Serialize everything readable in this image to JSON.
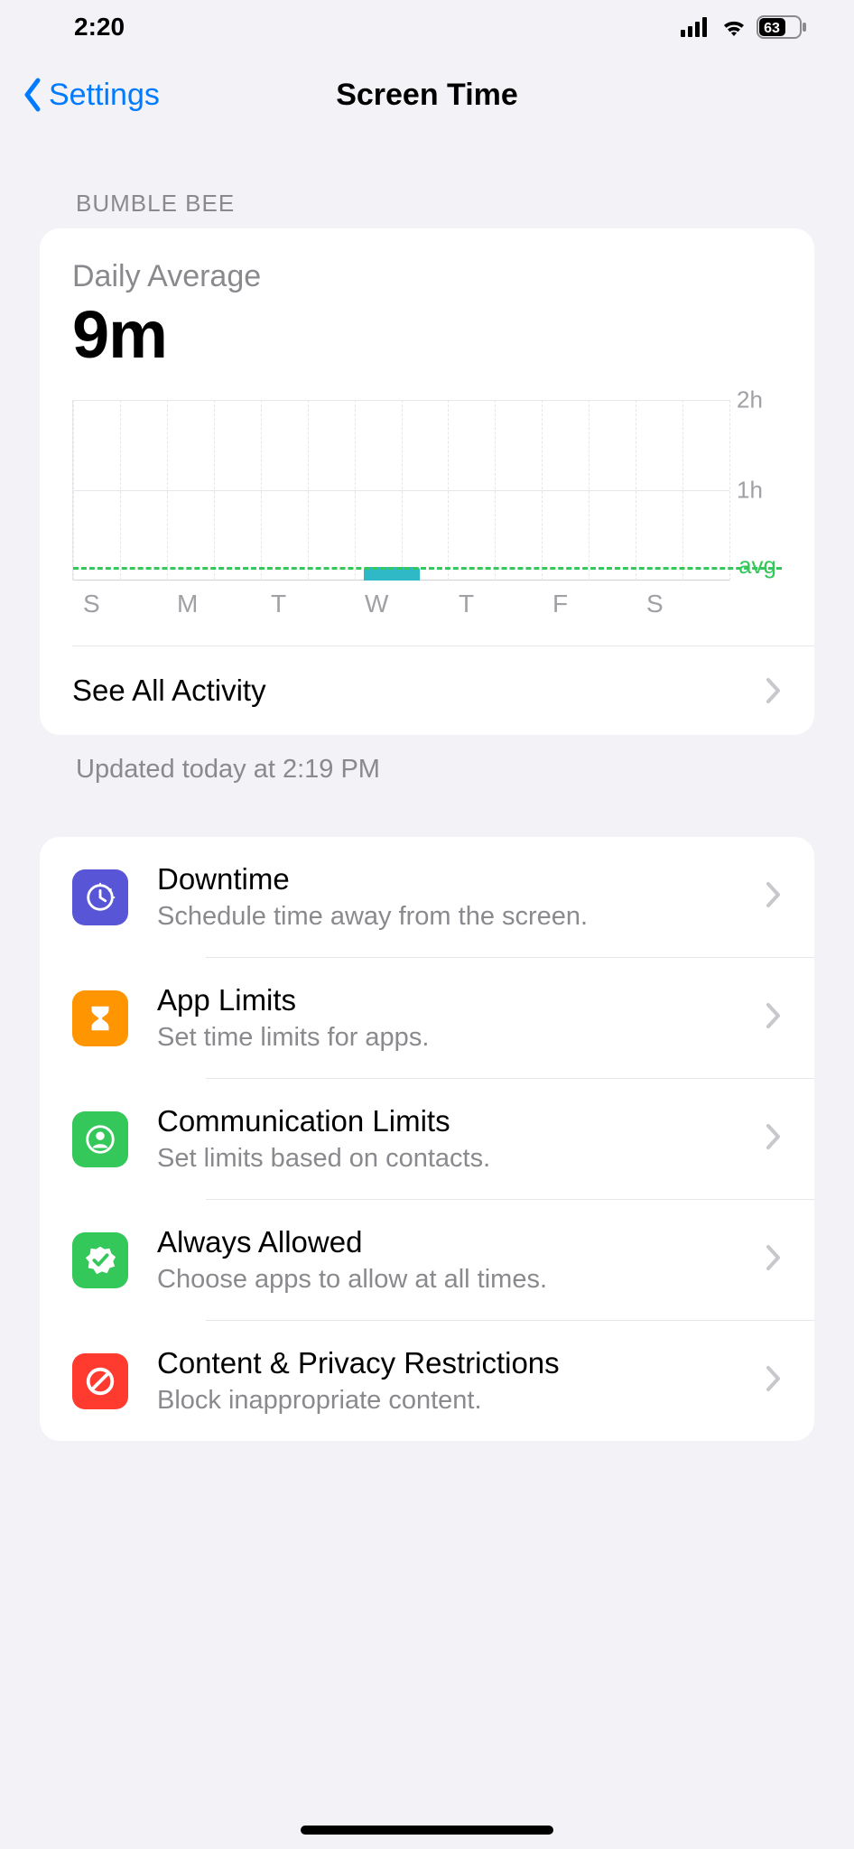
{
  "status": {
    "time": "2:20",
    "battery": "63"
  },
  "nav": {
    "back_label": "Settings",
    "title": "Screen Time"
  },
  "section_header": "BUMBLE BEE",
  "summary": {
    "label": "Daily Average",
    "value": "9m",
    "see_all_label": "See All Activity",
    "updated_note": "Updated today at 2:19 PM"
  },
  "chart_data": {
    "type": "bar",
    "categories": [
      "S",
      "M",
      "T",
      "W",
      "T",
      "F",
      "S"
    ],
    "values": [
      0,
      0,
      0,
      9,
      0,
      0,
      0
    ],
    "y_ticks": [
      "2h",
      "1h"
    ],
    "avg_label": "avg",
    "avg_value_minutes": 9,
    "ylim_minutes": [
      0,
      120
    ],
    "xlabel": "",
    "ylabel": ""
  },
  "options": [
    {
      "key": "downtime",
      "title": "Downtime",
      "sub": "Schedule time away from the screen.",
      "icon": "clock",
      "color": "purple"
    },
    {
      "key": "applimits",
      "title": "App Limits",
      "sub": "Set time limits for apps.",
      "icon": "hourglass",
      "color": "orange"
    },
    {
      "key": "comm",
      "title": "Communication Limits",
      "sub": "Set limits based on contacts.",
      "icon": "contact",
      "color": "green"
    },
    {
      "key": "always",
      "title": "Always Allowed",
      "sub": "Choose apps to allow at all times.",
      "icon": "checkbadge",
      "color": "green"
    },
    {
      "key": "content",
      "title": "Content & Privacy Restrictions",
      "sub": "Block inappropriate content.",
      "icon": "noentry",
      "color": "red"
    }
  ]
}
